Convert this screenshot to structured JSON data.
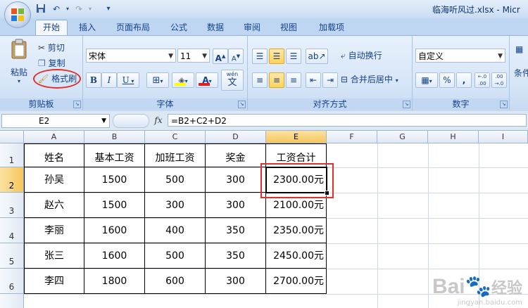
{
  "window": {
    "title": "临海听风过.xlsx - Micr",
    "qa_save_icon": "save-icon",
    "qa_undo_icon": "undo-icon",
    "qa_redo_icon": "redo-icon"
  },
  "tabs": [
    {
      "label": "开始",
      "active": true
    },
    {
      "label": "插入"
    },
    {
      "label": "页面布局"
    },
    {
      "label": "公式"
    },
    {
      "label": "数据"
    },
    {
      "label": "审阅"
    },
    {
      "label": "视图"
    },
    {
      "label": "加载项"
    }
  ],
  "clipboard": {
    "paste": "粘贴",
    "cut": "剪切",
    "copy": "复制",
    "format_painter": "格式刷",
    "group_label": "剪贴板",
    "highlight_color": "#e0302b"
  },
  "font": {
    "name": "宋体",
    "size": "11",
    "grow": "A",
    "shrink": "A",
    "bold": "B",
    "italic": "I",
    "underline": "U",
    "font_color_label": "A",
    "phonetic": "wén",
    "phonetic_char": "文",
    "group_label": "字体",
    "font_color": "#e02020",
    "fill_color": "#ffff00"
  },
  "alignment": {
    "wrap_text": "自动换行",
    "merge_center": "合并后居中",
    "group_label": "对齐方式"
  },
  "number": {
    "format": "自定义",
    "percent": "%",
    "comma": ",",
    "inc_decimal": "←.0 .00",
    "dec_decimal": ".00 →.0",
    "group_label": "数字"
  },
  "styles": {
    "partial_label": "条件"
  },
  "formula_bar": {
    "name_box": "E2",
    "fx": "fx",
    "formula": "=B2+C2+D2"
  },
  "sheet": {
    "columns": [
      "A",
      "B",
      "C",
      "D",
      "E",
      "F",
      "G",
      "H",
      "I"
    ],
    "active_column": "E",
    "rows": [
      "1",
      "2",
      "3",
      "4",
      "5",
      "6"
    ],
    "active_row": "2",
    "header": [
      "姓名",
      "基本工资",
      "加班工资",
      "奖金",
      "工资合计"
    ],
    "data": [
      [
        "孙吴",
        "1500",
        "500",
        "300",
        "2300.00元"
      ],
      [
        "赵六",
        "1500",
        "300",
        "300",
        "2100.00元"
      ],
      [
        "李丽",
        "1600",
        "400",
        "350",
        "2350.00元"
      ],
      [
        "张三",
        "1600",
        "500",
        "350",
        "2450.00元"
      ],
      [
        "李四",
        "1800",
        "600",
        "300",
        "2700.00元"
      ]
    ],
    "selected_cell": "E2",
    "highlight_color": "#e0302b"
  },
  "watermark": {
    "brand": "Bai",
    "brand2": "经验",
    "url": "jingyan.baidu.com"
  }
}
